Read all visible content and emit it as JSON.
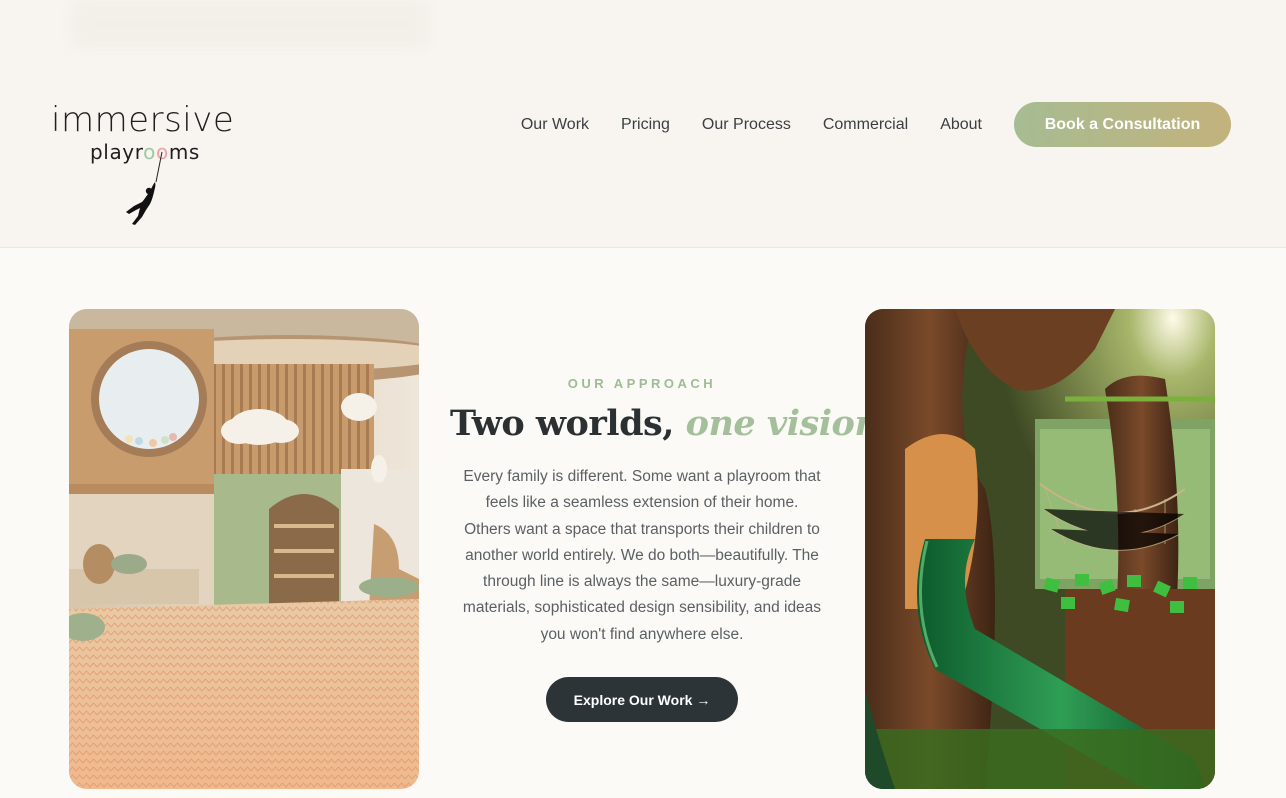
{
  "brand": {
    "logo_word": "immersive",
    "logo_sub": "playrooms",
    "balloon_colors": [
      "#9dc9a6",
      "#f0a4a8"
    ]
  },
  "nav": {
    "items": [
      {
        "label": "Our Work"
      },
      {
        "label": "Pricing"
      },
      {
        "label": "Our Process"
      },
      {
        "label": "Commercial"
      },
      {
        "label": "About"
      }
    ],
    "cta_label": "Book a Consultation"
  },
  "approach": {
    "eyebrow": "OUR APPROACH",
    "heading_plain": "Two worlds, ",
    "heading_accent": "one vision",
    "body": "Every family is different. Some want a playroom that feels like a seamless extension of their home. Others want a space that transports their children to another world entirely. We do both—beautifully. The through line is always the same—luxury-grade materials, sophisticated design sensibility, and ideas you won't find anywhere else.",
    "button_label": "Explore Our Work →"
  },
  "colors": {
    "accent_green": "#a3c09a",
    "cta_gradient_start": "#a6bc92",
    "cta_gradient_end": "#c3b27c",
    "dark_button": "#2c3438"
  },
  "images": {
    "left": "modern-wood-playroom-photo",
    "right": "treehouse-slide-playroom-photo"
  }
}
